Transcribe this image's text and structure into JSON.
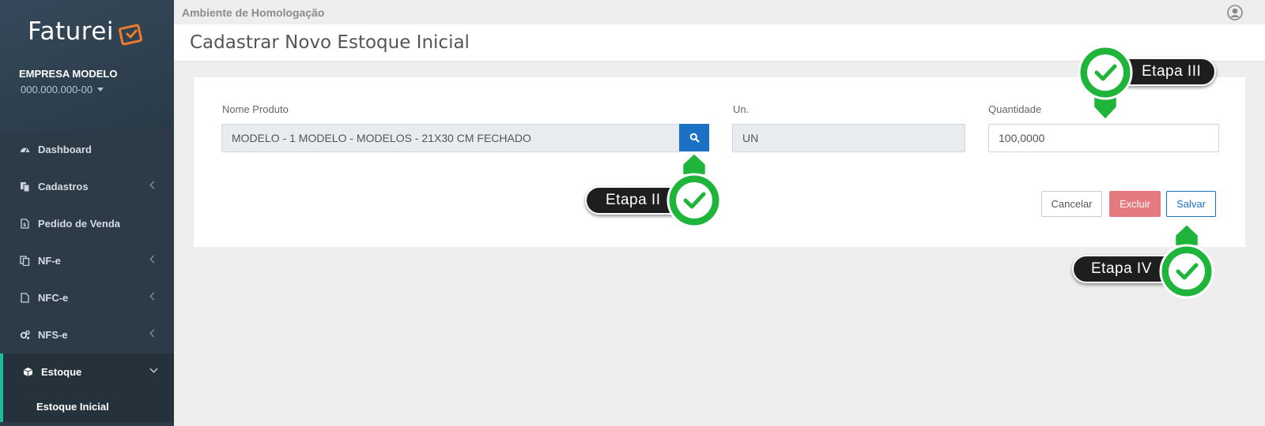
{
  "sidebar": {
    "logo_text": "Faturei",
    "company_name": "EMPRESA MODELO",
    "company_document": "000.000.000-00",
    "items": [
      {
        "label": "Dashboard",
        "icon": "dashboard-icon"
      },
      {
        "label": "Cadastros",
        "icon": "copy-icon"
      },
      {
        "label": "Pedido de Venda",
        "icon": "file-icon"
      },
      {
        "label": "NF-e",
        "icon": "files-icon"
      },
      {
        "label": "NFC-e",
        "icon": "file-outline-icon"
      },
      {
        "label": "NFS-e",
        "icon": "gears-icon"
      },
      {
        "label": "Estoque",
        "icon": "cube-icon"
      }
    ],
    "active_subitem": "Estoque Inicial"
  },
  "header": {
    "environment": "Ambiente de Homologação",
    "page_title": "Cadastrar Novo Estoque Inicial"
  },
  "form": {
    "product_label": "Nome Produto",
    "product_value": "MODELO - 1 MODELO - MODELOS - 21X30 CM FECHADO",
    "unit_label": "Un.",
    "unit_value": "UN",
    "quantity_label": "Quantidade",
    "quantity_value": "100,0000"
  },
  "actions": {
    "cancel_label": "Cancelar",
    "delete_label": "Excluir",
    "save_label": "Salvar"
  },
  "callouts": {
    "step2": "Etapa II",
    "step3": "Etapa III",
    "step4": "Etapa IV"
  },
  "colors": {
    "sidebar_bg": "#2c3b47",
    "accent_teal": "#1abc9c",
    "primary_blue": "#1b72c4",
    "danger": "#e47a80",
    "callout_green": "#1fb53a"
  }
}
